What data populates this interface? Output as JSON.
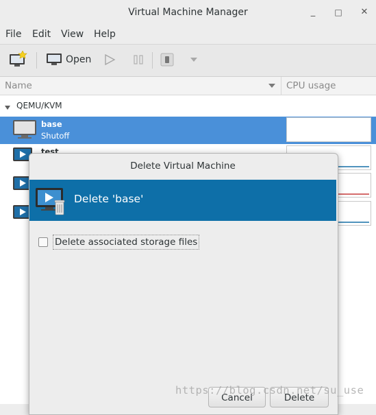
{
  "window": {
    "title": "Virtual Machine Manager",
    "minimize": "_",
    "maximize": "□",
    "close": "✕"
  },
  "menu": {
    "file": "File",
    "edit": "Edit",
    "view": "View",
    "help": "Help"
  },
  "toolbar": {
    "open_label": "Open",
    "new_icon": "new-vm-icon",
    "run_icon": "play-icon",
    "pause_icon": "pause-icon",
    "shutdown_icon": "power-icon"
  },
  "columns": {
    "name": "Name",
    "cpu": "CPU usage"
  },
  "list": {
    "group": "QEMU/KVM",
    "vms": [
      {
        "name": "base",
        "status": "Shutoff"
      },
      {
        "name": "test",
        "status": ""
      },
      {
        "name": "",
        "status": ""
      },
      {
        "name": "",
        "status": ""
      }
    ]
  },
  "dialog": {
    "title": "Delete Virtual Machine",
    "heading": "Delete 'base'",
    "checkbox_label": "Delete associated storage files",
    "checkbox_checked": false,
    "cancel": "Cancel",
    "delete": "Delete"
  },
  "watermark": "https://blog.csdn.net/su_use",
  "colors": {
    "selection": "#4a90d9",
    "banner": "#0e6fa8"
  }
}
